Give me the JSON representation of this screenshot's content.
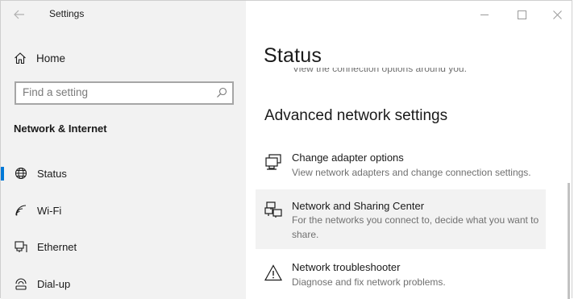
{
  "window": {
    "title": "Settings"
  },
  "sidebar": {
    "home_label": "Home",
    "search_placeholder": "Find a setting",
    "section_title": "Network & Internet",
    "items": [
      {
        "label": "Status",
        "icon": "globe-icon",
        "selected": true
      },
      {
        "label": "Wi-Fi",
        "icon": "wifi-icon",
        "selected": false
      },
      {
        "label": "Ethernet",
        "icon": "ethernet-icon",
        "selected": false
      },
      {
        "label": "Dial-up",
        "icon": "dial-up-icon",
        "selected": false
      }
    ]
  },
  "main": {
    "title": "Status",
    "cut_text": "View the connection options around you.",
    "advanced_title": "Advanced network settings",
    "items": [
      {
        "title": "Change adapter options",
        "desc": "View network adapters and change connection settings.",
        "icon": "adapter-icon"
      },
      {
        "title": "Network and Sharing Center",
        "desc": "For the networks you connect to, decide what you want to share.",
        "icon": "sharing-center-icon"
      },
      {
        "title": "Network troubleshooter",
        "desc": "Diagnose and fix network problems.",
        "icon": "warning-icon"
      }
    ]
  },
  "colors": {
    "accent": "#0078d7",
    "sidebar_bg": "#f2f2f2",
    "hover_bg": "#f2f2f2",
    "secondary_text": "#707070"
  }
}
